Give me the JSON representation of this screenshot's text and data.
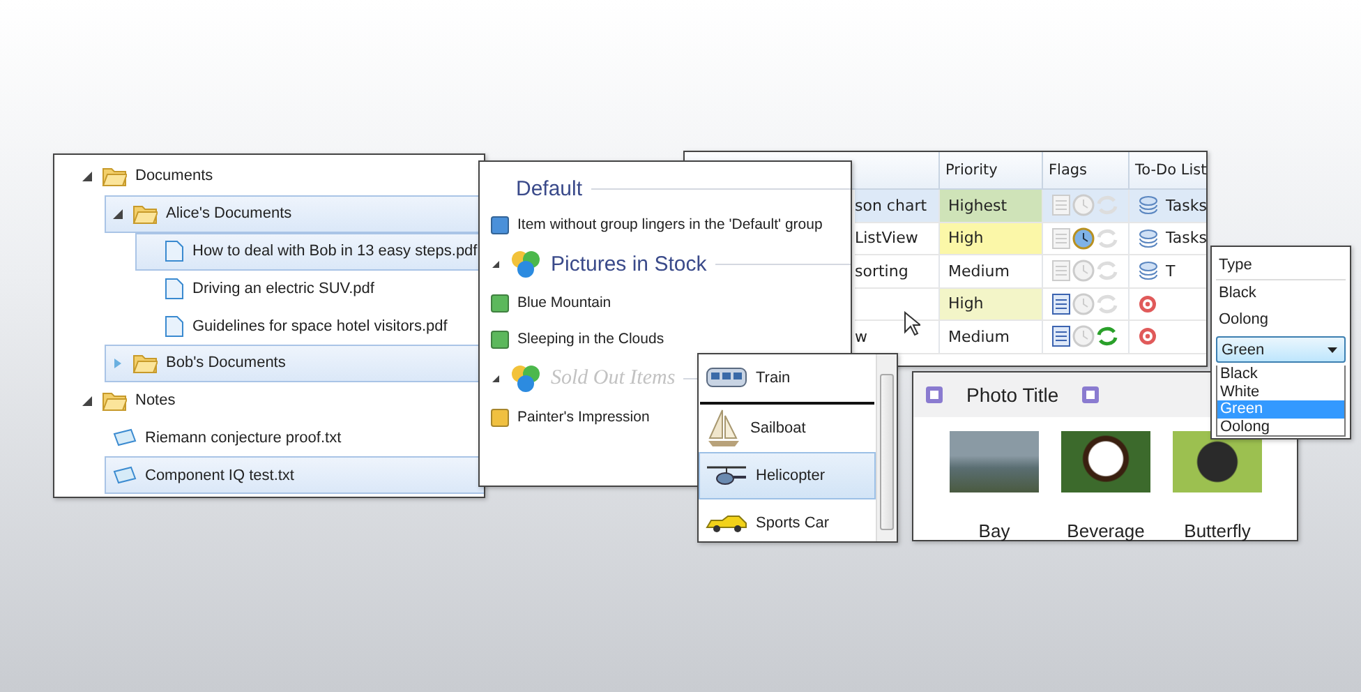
{
  "tree": [
    {
      "label": "Documents",
      "kind": "folder",
      "expanded": true,
      "selected": false,
      "children": [
        {
          "label": "Alice's Documents",
          "kind": "folder",
          "expanded": true,
          "selected": true,
          "children": [
            {
              "label": "How to deal with Bob in 13 easy steps.pdf",
              "kind": "pdf",
              "selected": true
            },
            {
              "label": "Driving an electric SUV.pdf",
              "kind": "pdf",
              "selected": false
            },
            {
              "label": "Guidelines for space hotel visitors.pdf",
              "kind": "pdf",
              "selected": false
            }
          ]
        },
        {
          "label": "Bob's Documents",
          "kind": "folder",
          "expanded": false,
          "selected": true
        }
      ]
    },
    {
      "label": "Notes",
      "kind": "folder",
      "expanded": true,
      "selected": false,
      "children": [
        {
          "label": "Riemann conjecture proof.txt",
          "kind": "txt",
          "selected": false
        },
        {
          "label": "Component IQ test.txt",
          "kind": "txt",
          "selected": true
        }
      ]
    }
  ],
  "groups": [
    {
      "title": "Default",
      "kind": "plain",
      "disabled": false,
      "items": [
        {
          "label": "Item without group lingers in the 'Default' group",
          "color": "#4a90d9"
        }
      ]
    },
    {
      "title": "Pictures in Stock",
      "kind": "collapsible",
      "disabled": false,
      "items": [
        {
          "label": "Blue Mountain",
          "color": "#5cb85c"
        },
        {
          "label": "Sleeping in the Clouds",
          "color": "#5cb85c"
        }
      ]
    },
    {
      "title": "Sold Out Items",
      "kind": "collapsible",
      "disabled": true,
      "items": [
        {
          "label": "Painter's Impression",
          "color": "#f0c040"
        }
      ]
    }
  ],
  "table": {
    "columns": [
      "Priority",
      "Flags",
      "To-Do List"
    ],
    "rows": [
      {
        "column_1": "son chart",
        "priority": "Highest",
        "color": "#cfe3b8",
        "selected": true,
        "flags": {
          "note": false,
          "clock": false,
          "repeat": false
        },
        "kind": "tasks",
        "todo": "Tasks"
      },
      {
        "column_1": "ListView",
        "priority": "High",
        "color": "#fbf7a8",
        "selected": false,
        "flags": {
          "note": false,
          "clock": true,
          "repeat": false
        },
        "kind": "tasks",
        "todo": "Tasks"
      },
      {
        "column_1": "sorting",
        "priority": "Medium",
        "color": "#ffffff",
        "selected": false,
        "flags": {
          "note": false,
          "clock": false,
          "repeat": false
        },
        "kind": "tasks",
        "todo": "T"
      },
      {
        "column_1": "",
        "priority": "High",
        "color": "#f3f5c8",
        "selected": false,
        "flags": {
          "note": true,
          "clock": false,
          "repeat": false
        },
        "kind": "target",
        "todo": ""
      },
      {
        "column_1": "w",
        "priority": "Medium",
        "color": "#ffffff",
        "selected": false,
        "flags": {
          "note": true,
          "clock": false,
          "repeat": true
        },
        "kind": "target",
        "todo": ""
      }
    ]
  },
  "type_popup": {
    "title": "Type",
    "items": [
      "Black",
      "Oolong"
    ],
    "combo": {
      "value": "Green",
      "options": [
        {
          "label": "Black",
          "selected": false
        },
        {
          "label": "White",
          "selected": false
        },
        {
          "label": "Green",
          "selected": true
        },
        {
          "label": "Oolong",
          "selected": false
        }
      ]
    }
  },
  "vehicles": [
    {
      "label": "Train",
      "kind": "train",
      "selected": false
    },
    {
      "label": "Sailboat",
      "kind": "sailboat",
      "selected": false
    },
    {
      "label": "Helicopter",
      "kind": "helicopter",
      "selected": true
    },
    {
      "label": "Sports Car",
      "kind": "car",
      "selected": false
    }
  ],
  "photos": {
    "title": "Photo Title",
    "items": [
      {
        "caption": "Bay",
        "kind": "landscape"
      },
      {
        "caption": "Beverage",
        "kind": "cup"
      },
      {
        "caption": "Butterfly",
        "kind": "butterfly"
      }
    ]
  }
}
